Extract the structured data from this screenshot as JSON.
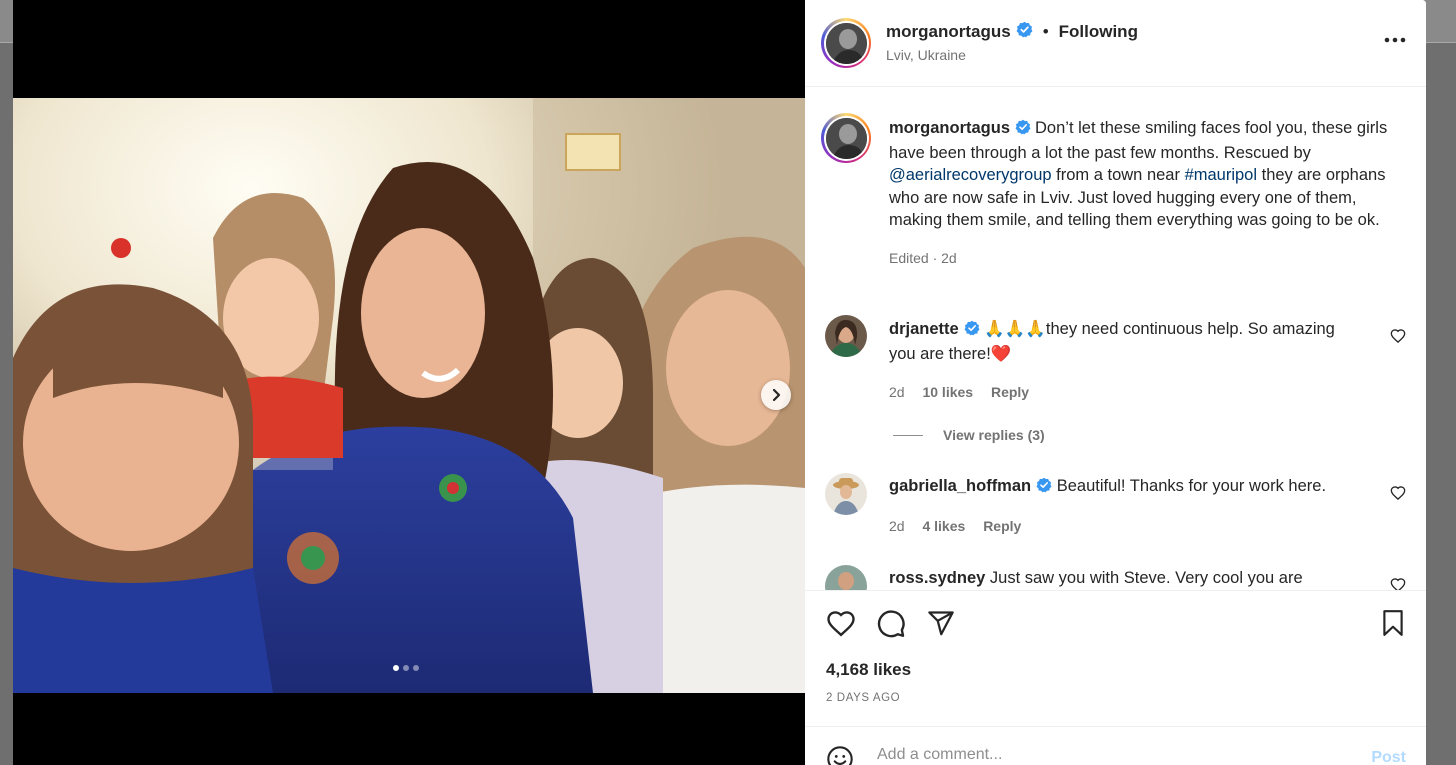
{
  "post": {
    "username": "morganortagus",
    "following_label": "Following",
    "separator": "•",
    "location": "Lviv, Ukraine",
    "more_label": "•••",
    "carousel": {
      "current": 1,
      "total": 3
    }
  },
  "caption": {
    "username": "morganortagus",
    "text_1": "Don’t let these smiling faces fool you, these girls have been through a lot the past few months. Rescued by ",
    "mention": "@aerialrecoverygroup",
    "text_2": " from a town near ",
    "hashtag": "#mauripol",
    "text_3": " they are orphans who are now safe in Lviv. Just loved hugging every one of them, making them smile, and telling them everything was going to be ok.",
    "meta": "Edited · 2d"
  },
  "comments": [
    {
      "username": "drjanette",
      "text": " 🙏🙏🙏they need continuous help. So amazing you are there!❤️",
      "age": "2d",
      "likes": "10 likes",
      "reply": "Reply",
      "view_replies": "View replies (3)"
    },
    {
      "username": "gabriella_hoffman",
      "text": " Beautiful! Thanks for your work here.",
      "age": "2d",
      "likes": "4 likes",
      "reply": "Reply"
    },
    {
      "username": "ross.sydney",
      "text": " Just saw you with Steve. Very cool you are"
    }
  ],
  "engagement": {
    "likes": "4,168 likes",
    "date": "2 DAYS AGO"
  },
  "add_comment": {
    "placeholder": "Add a comment...",
    "post_label": "Post"
  },
  "colors": {
    "verified": "#3897f0",
    "link": "#00376b",
    "post_button": "#b3dbff",
    "heart": "#ed4956"
  },
  "icons": [
    "verified-icon",
    "more-icon",
    "chevron-right-icon",
    "heart-icon",
    "comment-icon",
    "share-icon",
    "bookmark-icon",
    "emoji-icon"
  ]
}
